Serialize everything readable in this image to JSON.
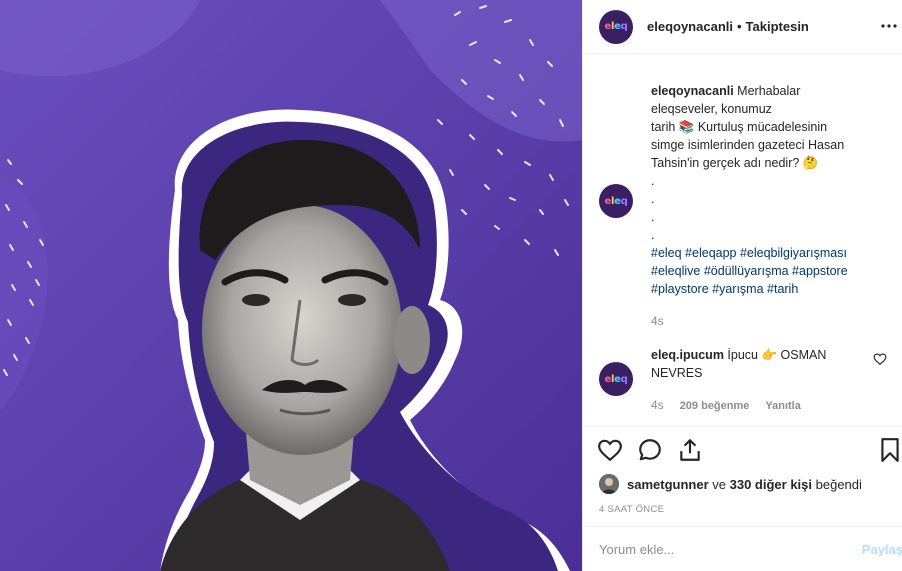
{
  "post": {
    "username": "eleqoynacanli",
    "separator": "•",
    "follow_status": "Takiptesin",
    "more_label": "•••"
  },
  "caption": {
    "username": "eleqoynacanli",
    "text_lines": [
      "Merhabalar",
      "eleqseveler, konumuz",
      "tarih 📚 Kurtuluş mücadelesinin",
      "simge isimlerinden gazeteci Hasan",
      "Tahsin'in gerçek adı nedir? 🤔",
      ".",
      ".",
      ".",
      "."
    ],
    "hashtags_lines": [
      "#eleq #eleqapp #eleqbilgiyarışması",
      "#eleqlive #ödüllüyarışma #appstore",
      "#playstore #yarışma #tarih"
    ],
    "age": "4s"
  },
  "reply": {
    "username": "eleq.ipucum",
    "text": "İpucu 👉 OSMAN NEVRES",
    "age": "4s",
    "likes": "209 beğenme",
    "reply_label": "Yanıtla"
  },
  "avatar_logo": {
    "l1": "e",
    "l2": "l",
    "l3": "e",
    "l4": "q"
  },
  "icons": {
    "like": "heart-icon",
    "comment": "comment-icon",
    "share": "share-icon",
    "save": "bookmark-icon",
    "reply_like": "heart-small-icon"
  },
  "likes_summary": {
    "user": "sametgunner",
    "connector": "ve",
    "others": "330 diğer kişi",
    "suffix": "beğendi"
  },
  "timestamp": "4 SAAT ÖNCE",
  "comment_input": {
    "placeholder": "Yorum ekle...",
    "post_label": "Paylaş"
  },
  "colors": {
    "image_bg": "#5a3fa8",
    "hashtag": "#00376b",
    "muted": "#8e8e8e",
    "post_button": "#b2dffc"
  }
}
